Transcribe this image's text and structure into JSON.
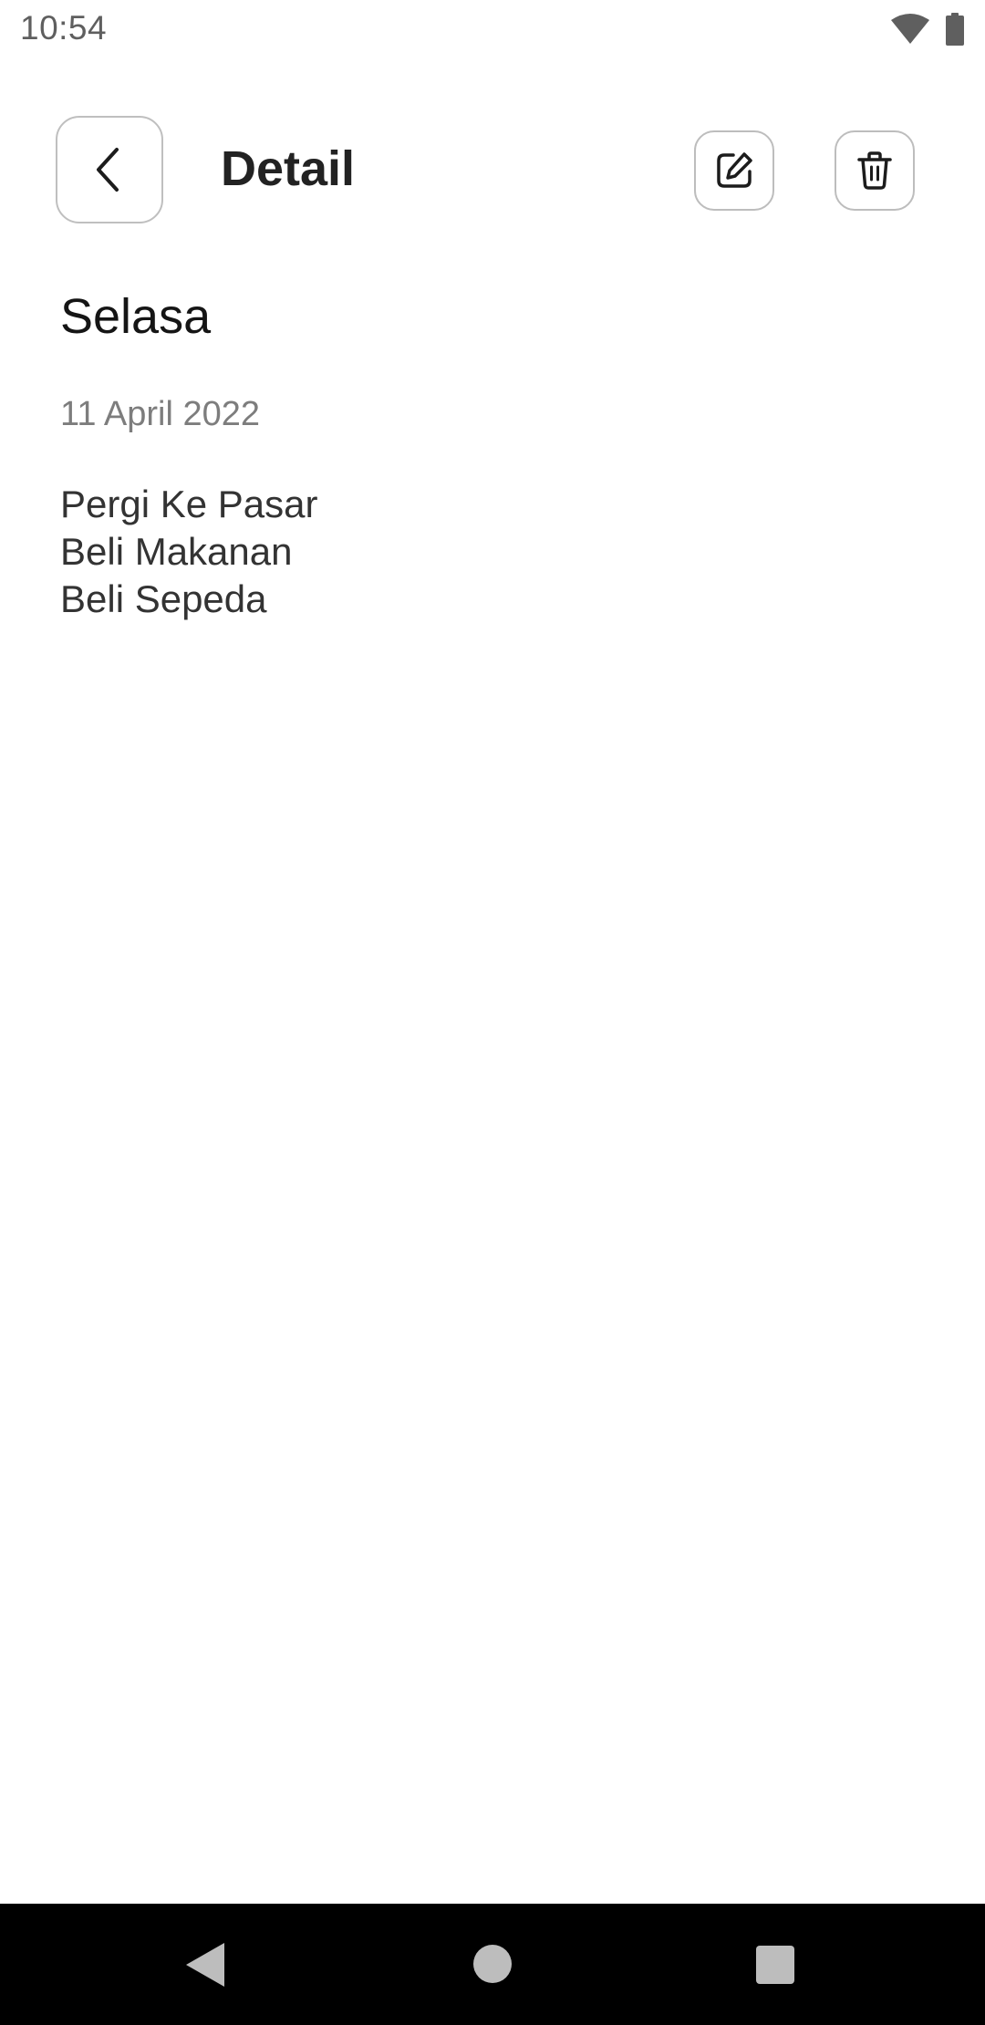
{
  "status_bar": {
    "time": "10:54",
    "icons": [
      "wifi-icon",
      "battery-icon"
    ]
  },
  "header": {
    "title": "Detail",
    "back_icon": "chevron-left-icon",
    "edit_icon": "edit-icon",
    "delete_icon": "trash-icon"
  },
  "note": {
    "title": "Selasa",
    "date": "11 April 2022",
    "body_lines": [
      "Pergi Ke Pasar",
      "Beli Makanan",
      "Beli Sepeda"
    ]
  },
  "nav_bar": {
    "buttons": [
      "back-nav-icon",
      "home-nav-icon",
      "recents-nav-icon"
    ]
  },
  "colors": {
    "background": "#ffffff",
    "text_primary": "#222222",
    "text_secondary": "#7d7d7d",
    "border": "#bdbdbd",
    "nav_bar": "#000000"
  }
}
